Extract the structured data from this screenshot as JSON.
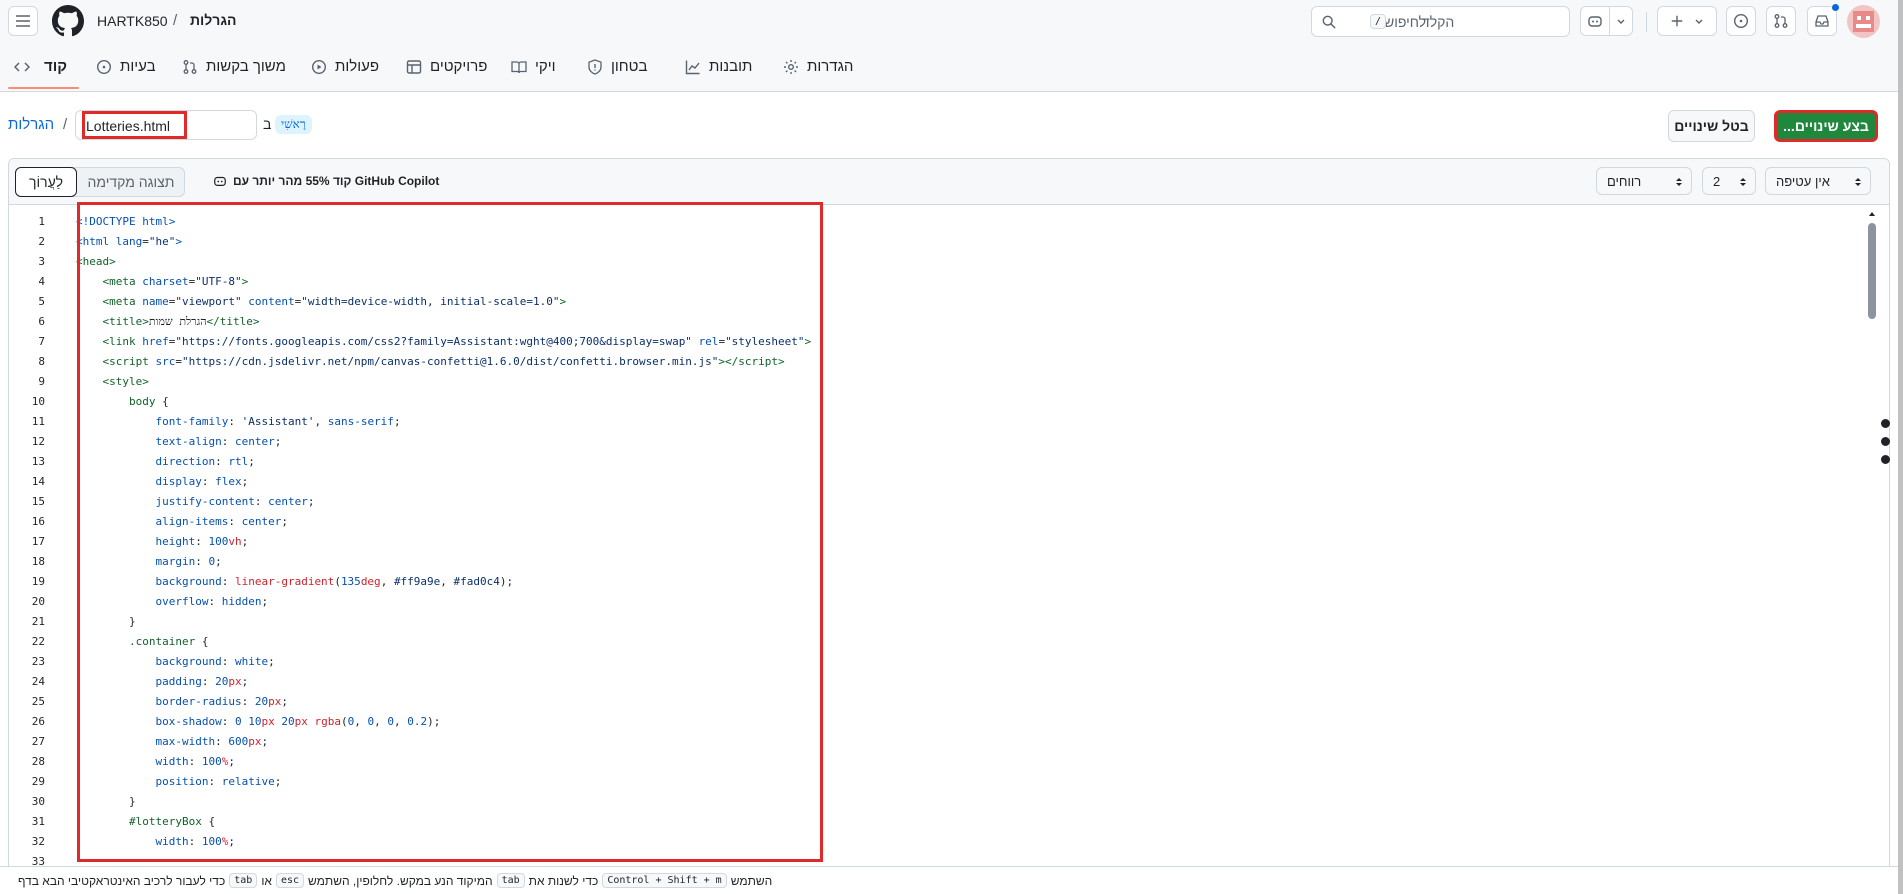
{
  "header": {
    "owner": "HARTK850",
    "separator": "/",
    "repo": "הגרלות",
    "search_placeholder": "הקלד",
    "search_hint": "לחיפוש",
    "search_key": "/"
  },
  "tabs": [
    {
      "label": "קוד"
    },
    {
      "label": "בעיות"
    },
    {
      "label": "משוך בקשות"
    },
    {
      "label": "פעולות"
    },
    {
      "label": "פרויקטים"
    },
    {
      "label": "ויקי"
    },
    {
      "label": "בטחון"
    },
    {
      "label": "תובנות"
    },
    {
      "label": "הגדרות"
    }
  ],
  "path": {
    "repo_link": "הגרלות",
    "separator": "/",
    "filename": "Lotteries.html",
    "in_label": "ב",
    "branch": "רָאשִׁי"
  },
  "actions": {
    "cancel_label": "בטל שינויים",
    "commit_label": "...בצע שינויים"
  },
  "editor": {
    "edit_tab": "לַעֲרוֹך",
    "preview_tab": "תצוגה מקדימה",
    "copilot_text": "קוד 55% מהר יותר עם GitHub Copilot",
    "indent_mode": "רווחים",
    "indent_size": "2",
    "wrap_mode": "אין עטיפה"
  },
  "code_lines": [
    {
      "n": "1",
      "html": "<span class=\"k\">&lt;!DOCTYPE html&gt;</span>"
    },
    {
      "n": "2",
      "html": "<span class=\"k\">&lt;html</span> <span class=\"k\">lang</span>=<span class=\"s\">\"he\"</span><span class=\"k\">&gt;</span>"
    },
    {
      "n": "3",
      "html": "<span class=\"t\">&lt;head&gt;</span>"
    },
    {
      "n": "4",
      "html": "    <span class=\"t\">&lt;meta</span> <span class=\"k\">charset</span>=<span class=\"s\">\"UTF-8\"</span><span class=\"t\">&gt;</span>"
    },
    {
      "n": "5",
      "html": "    <span class=\"t\">&lt;meta</span> <span class=\"k\">name</span>=<span class=\"s\">\"viewport\"</span> <span class=\"k\">content</span>=<span class=\"s\">\"width=device-width, initial-scale=1.0\"</span><span class=\"t\">&gt;</span>"
    },
    {
      "n": "6",
      "html": "    <span class=\"t\">&lt;title&gt;</span>הגרלת שמות<span class=\"t\">&lt;/title&gt;</span>"
    },
    {
      "n": "7",
      "html": "    <span class=\"t\">&lt;link</span> <span class=\"k\">href</span>=<span class=\"s\">\"https://fonts.googleapis.com/css2?family=Assistant:wght@400;700&amp;display=swap\"</span> <span class=\"k\">rel</span>=<span class=\"s\">\"stylesheet\"</span><span class=\"t\">&gt;</span>"
    },
    {
      "n": "8",
      "html": "    <span class=\"t\">&lt;script</span> <span class=\"k\">src</span>=<span class=\"s\">\"https://cdn.jsdelivr.net/npm/canvas-confetti@1.6.0/dist/confetti.browser.min.js\"</span><span class=\"t\">&gt;&lt;/script&gt;</span>"
    },
    {
      "n": "9",
      "html": "    <span class=\"t\">&lt;style&gt;</span>"
    },
    {
      "n": "10",
      "html": "        <span class=\"t\">body</span> {"
    },
    {
      "n": "11",
      "html": "            <span class=\"k\">font-family</span>: <span class=\"s\">'Assistant'</span>, <span class=\"k\">sans-serif</span>;"
    },
    {
      "n": "12",
      "html": "            <span class=\"k\">text-align</span>: <span class=\"k\">center</span>;"
    },
    {
      "n": "13",
      "html": "            <span class=\"k\">direction</span>: <span class=\"k\">rtl</span>;"
    },
    {
      "n": "14",
      "html": "            <span class=\"k\">display</span>: <span class=\"k\">flex</span>;"
    },
    {
      "n": "15",
      "html": "            <span class=\"k\">justify-content</span>: <span class=\"k\">center</span>;"
    },
    {
      "n": "16",
      "html": "            <span class=\"k\">align-items</span>: <span class=\"k\">center</span>;"
    },
    {
      "n": "17",
      "html": "            <span class=\"k\">height</span>: <span class=\"k\">100</span><span class=\"r\">vh</span>;"
    },
    {
      "n": "18",
      "html": "            <span class=\"k\">margin</span>: <span class=\"k\">0</span>;"
    },
    {
      "n": "19",
      "html": "            <span class=\"k\">background</span>: <span class=\"r\">linear-gradient</span>(<span class=\"k\">135</span><span class=\"r\">deg</span>, <span class=\"s\">#ff9a9e</span>, <span class=\"s\">#fad0c4</span>);"
    },
    {
      "n": "20",
      "html": "            <span class=\"k\">overflow</span>: <span class=\"k\">hidden</span>;"
    },
    {
      "n": "21",
      "html": "        }"
    },
    {
      "n": "22",
      "html": "        <span class=\"t\">.container</span> {"
    },
    {
      "n": "23",
      "html": "            <span class=\"k\">background</span>: <span class=\"k\">white</span>;"
    },
    {
      "n": "24",
      "html": "            <span class=\"k\">padding</span>: <span class=\"k\">20</span><span class=\"r\">px</span>;"
    },
    {
      "n": "25",
      "html": "            <span class=\"k\">border-radius</span>: <span class=\"k\">20</span><span class=\"r\">px</span>;"
    },
    {
      "n": "26",
      "html": "            <span class=\"k\">box-shadow</span>: <span class=\"k\">0</span> <span class=\"k\">10</span><span class=\"r\">px</span> <span class=\"k\">20</span><span class=\"r\">px</span> <span class=\"r\">rgba</span>(<span class=\"k\">0</span>, <span class=\"k\">0</span>, <span class=\"k\">0</span>, <span class=\"k\">0.2</span>);"
    },
    {
      "n": "27",
      "html": "            <span class=\"k\">max-width</span>: <span class=\"k\">600</span><span class=\"r\">px</span>;"
    },
    {
      "n": "28",
      "html": "            <span class=\"k\">width</span>: <span class=\"k\">100</span><span class=\"r\">%</span>;"
    },
    {
      "n": "29",
      "html": "            <span class=\"k\">position</span>: <span class=\"k\">relative</span>;"
    },
    {
      "n": "30",
      "html": "        }"
    },
    {
      "n": "31",
      "html": "        <span class=\"t\">#lotteryBox</span> {"
    },
    {
      "n": "32",
      "html": "            <span class=\"k\">width</span>: <span class=\"k\">100</span><span class=\"r\">%</span>;"
    },
    {
      "n": "33",
      "html": ""
    }
  ],
  "status": {
    "part1": "השתמש",
    "key_combo": "Control + Shift + m",
    "part2": "כדי לשנות את",
    "key_tab": "tab",
    "part3": "המיקוד הנע במקש. לחלופין, השתמש",
    "key_esc": "esc",
    "part4": "או",
    "key_tab2": "tab",
    "part5": "כדי לעבור לרכיב האינטראקטיבי הבא בדף"
  },
  "colors": {
    "accent_blue": "#0969da",
    "commit_green": "#1f883d",
    "highlight_red": "#e02a2a",
    "tab_underline": "#fd8c73"
  }
}
